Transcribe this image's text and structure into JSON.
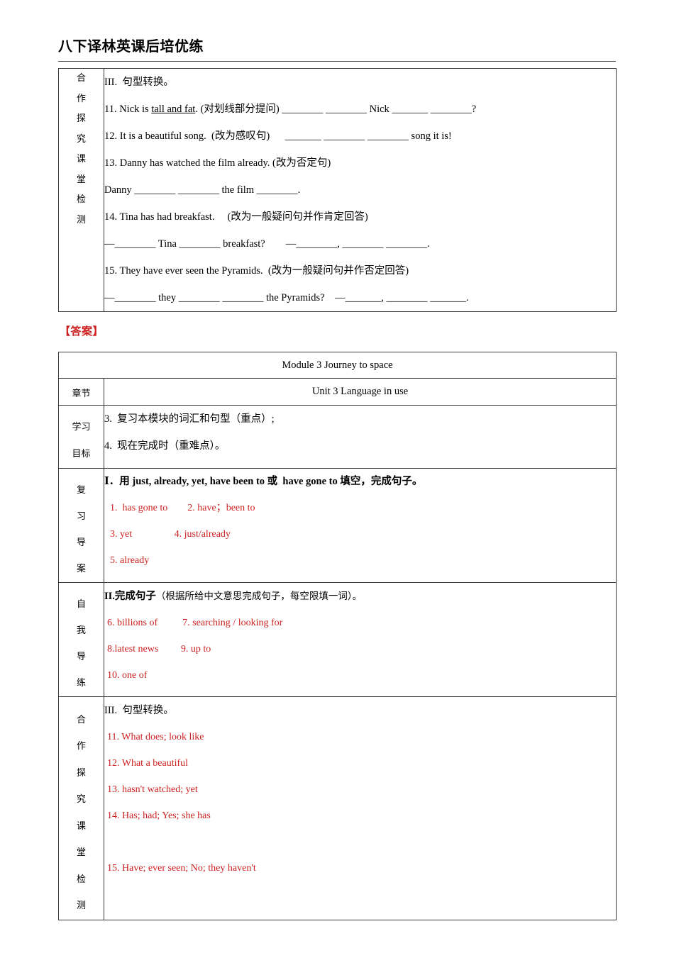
{
  "header": {
    "title": "八下译林英课后培优练"
  },
  "answer_tag": "【答案】",
  "worksheet_table": {
    "label_chars": [
      "合",
      "作",
      "探",
      "究",
      "课",
      "堂",
      "检",
      "测"
    ],
    "lines": [
      "III.  句型转换。",
      "11. Nick is tall and fat. (对划线部分提问) ________ ________ Nick _______ ________?",
      "12. It is a beautiful song.  (改为感叹句)      _______ ________ ________ song it is!",
      "13. Danny has watched the film already. (改为否定句)",
      "Danny ________ ________ the film ________.",
      "14. Tina has had breakfast.     (改为一般疑问句并作肯定回答)",
      "—________ Tina ________ breakfast?        —________, ________ ________.",
      "15. They have ever seen the Pyramids.  (改为一般疑问句并作否定回答)",
      "—________ they ________ ________ the Pyramids?    —_______, ________ _______."
    ],
    "line_parts": {
      "q11_prefix": "11. Nick is ",
      "q11_underlined": "tall and fat",
      "q11_suffix": ". (对划线部分提问) ________ ________ Nick _______ ________?"
    }
  },
  "answer_table": {
    "module_title": "Module 3 Journey to space",
    "section_label": "章节",
    "unit_title": "Unit 3 Language in use",
    "objectives_label_chars": [
      "学习",
      "目标"
    ],
    "objectives": [
      "3.  复习本模块的词汇和句型（重点）;",
      "4.  现在完成时（重难点）。"
    ],
    "review_label_chars": [
      "复",
      "习",
      "导",
      "案"
    ],
    "review_heading": "Ⅰ．用 just, already, yet, have been to 或  have gone to 填空，完成句子。",
    "review_answers": [
      "1.  has gone to        2. have；been to",
      "3. yet                 4. just/already",
      "5. already"
    ],
    "selfstudy_label_chars": [
      "自",
      "我",
      "导",
      "练"
    ],
    "selfstudy_heading_bold": "II.完成句子",
    "selfstudy_heading_rest": "（根据所给中文意思完成句子，每空限填一词）。",
    "selfstudy_answers": [
      "6. billions of          7. searching / looking for",
      "8.latest news         9. up to",
      "10. one of"
    ],
    "coop_label_chars": [
      "合",
      "作",
      "探",
      "究",
      "课",
      "堂",
      "检",
      "测"
    ],
    "coop_heading": "III.  句型转换。",
    "coop_answers": [
      "11. What does; look like",
      "12. What a beautiful",
      "13. hasn't watched; yet",
      "14. Has; had; Yes; she has",
      "15. Have; ever seen; No; they haven't"
    ]
  },
  "colors": {
    "answer_red": "#cc2020",
    "border": "#3a3a3a",
    "text": "#000000"
  }
}
